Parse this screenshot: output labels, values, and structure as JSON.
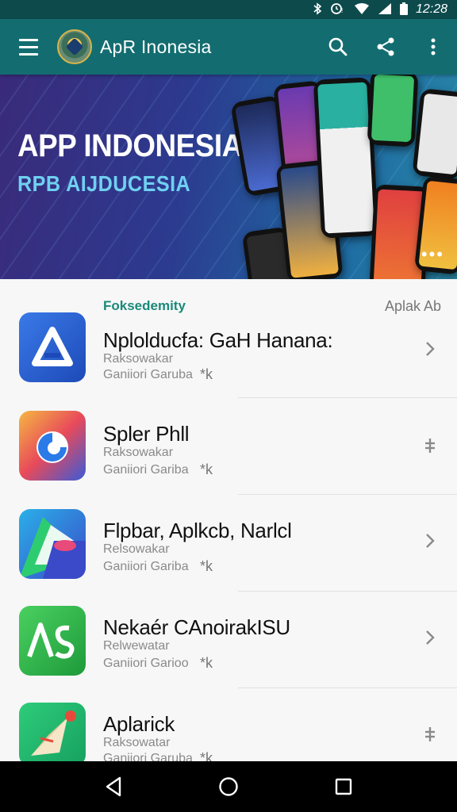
{
  "status_bar": {
    "time": "12:28",
    "icons": [
      "bluetooth-icon",
      "alarm-icon",
      "wifi-icon",
      "signal-icon",
      "battery-icon"
    ]
  },
  "toolbar": {
    "title": "ApR Inonesia",
    "icons": [
      "menu-icon",
      "app-logo",
      "search-icon",
      "share-icon",
      "more-vert-icon"
    ],
    "color": "#136d70"
  },
  "banner": {
    "title": "APP INDONESIA",
    "subtitle": "RPB AIJDUCESIA",
    "more": "•••"
  },
  "section": {
    "left_label": "Foksedemity",
    "right_label": "Aplak Ab",
    "accent": "#1a8a7a"
  },
  "apps": [
    {
      "title": "Nplolducfa: GaH Hanana:",
      "sub1": "Raksowakar",
      "sub2": "Ganiiori Garuba",
      "star": "*k",
      "action": "chevron-right-icon"
    },
    {
      "title": "Spler Phll",
      "sub1": "Raksowakar",
      "sub2": "Ganiiori Gariba",
      "star": "*k",
      "action": "drag-handle-icon"
    },
    {
      "title": "Flpbar, Aplkcb, Narlcl",
      "sub1": "Relsowakar",
      "sub2": "Ganiiori Gariba",
      "star": "*k",
      "action": "chevron-right-icon"
    },
    {
      "title": "Nekaér CAnoirakISU",
      "sub1": "Relwewatar",
      "sub2": "Ganiiori Garioo",
      "star": "*k",
      "action": "chevron-right-icon"
    },
    {
      "title": "Aplarick",
      "sub1": "Raksowatar",
      "sub2": "Ganiiori Garuba",
      "star": "*k",
      "action": "drag-handle-icon"
    }
  ],
  "nav": [
    "back-icon",
    "home-icon",
    "recents-icon"
  ]
}
